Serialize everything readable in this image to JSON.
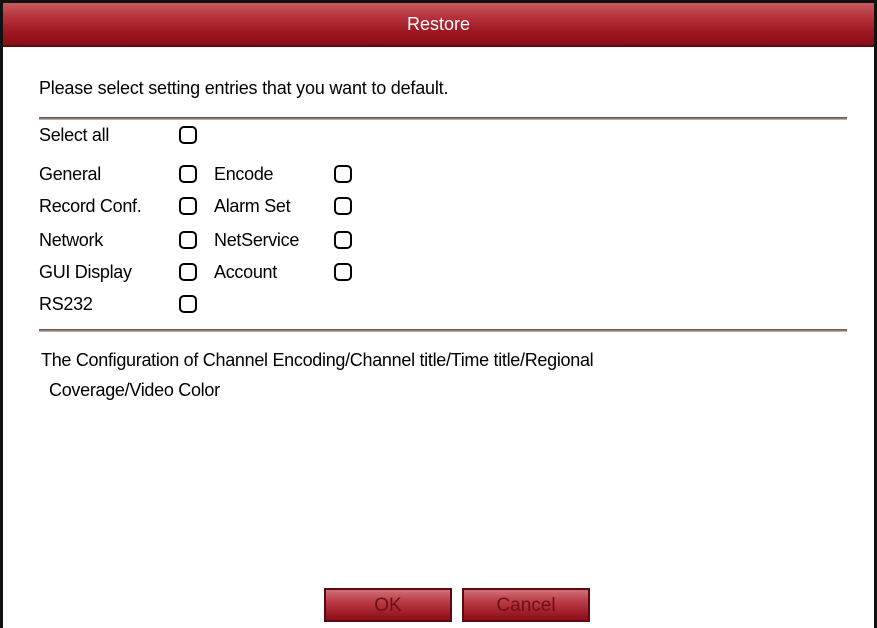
{
  "window": {
    "title": "Restore"
  },
  "prompt": "Please select setting entries that you want to default.",
  "options": {
    "select_all": "Select all",
    "general": "General",
    "encode": "Encode",
    "record_conf": "Record Conf.",
    "alarm_set": "Alarm Set",
    "network": "Network",
    "netservice": "NetService",
    "gui_display": "GUI Display",
    "account": "Account",
    "rs232": "RS232"
  },
  "checked": {
    "select_all": false,
    "general": false,
    "encode": false,
    "record_conf": false,
    "alarm_set": false,
    "network": false,
    "netservice": false,
    "gui_display": false,
    "account": false,
    "rs232": false
  },
  "description": {
    "line1": "The Configuration of Channel Encoding/Channel title/Time title/Regional",
    "line2": "Coverage/Video Color"
  },
  "buttons": {
    "ok": "OK",
    "cancel": "Cancel"
  },
  "colors": {
    "titlebar": "#9c1620",
    "button": "#a01e28"
  }
}
